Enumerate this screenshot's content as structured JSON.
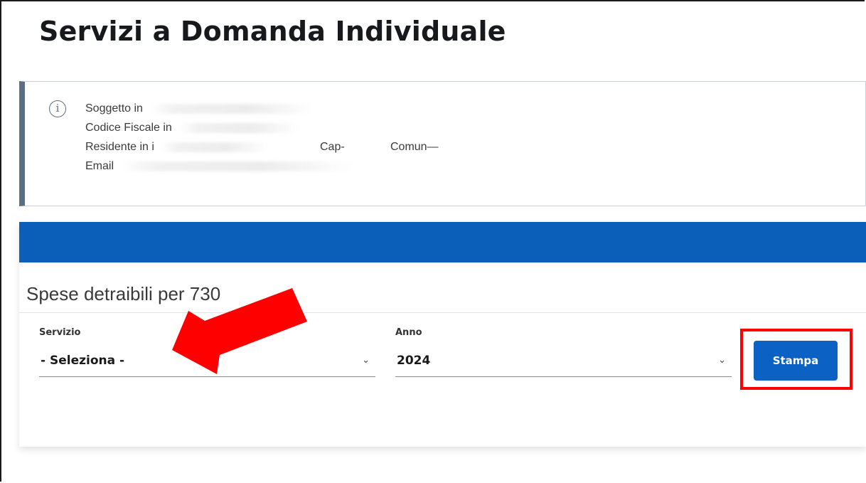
{
  "page": {
    "title": "Servizi a Domanda Individuale"
  },
  "info": {
    "icon": "info-circle-icon",
    "lines": {
      "soggetto": "Soggetto in",
      "codice_fiscale": "Codice Fiscale in",
      "residente": "Residente in i",
      "cap": "Cap-",
      "comune": "Comun—",
      "email": "Email"
    }
  },
  "section": {
    "title": "Spese detraibili per 730"
  },
  "form": {
    "servizio": {
      "label": "Servizio",
      "value": "- Seleziona -"
    },
    "anno": {
      "label": "Anno",
      "value": "2024"
    },
    "stampa_label": "Stampa"
  },
  "annotations": {
    "arrow_color": "#ff0000",
    "highlight_color": "#ff0000"
  },
  "colors": {
    "header_bar": "#0b5fb8",
    "primary_button": "#0b61c4",
    "info_border": "#5c6f82"
  }
}
